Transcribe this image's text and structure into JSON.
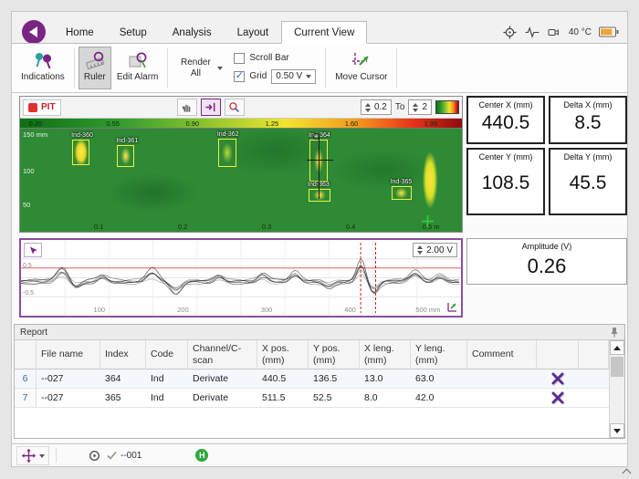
{
  "window": {
    "temperature": "40 °C"
  },
  "tabs": {
    "items": [
      "Home",
      "Setup",
      "Analysis",
      "Layout",
      "Current View"
    ]
  },
  "ribbon": {
    "indications_label": "Indications",
    "ruler_label": "Ruler",
    "edit_alarm_label": "Edit Alarm",
    "render_all_label": "Render All",
    "scroll_bar_label": "Scroll Bar",
    "grid_label": "Grid",
    "grid_value": "0.50 V",
    "move_cursor_label": "Move Cursor"
  },
  "cscan": {
    "channel_label": "PIT",
    "range_from": "0.2",
    "to_label": "To",
    "range_to": "2",
    "colorbar_ticks": [
      "0.20",
      "0.55",
      "0.90",
      "1.25",
      "1.60",
      "1.95"
    ],
    "y_ticks": [
      "150 mm",
      "100",
      "50"
    ],
    "x_ticks": [
      "0.1",
      "0.2",
      "0.3",
      "0.4",
      "0.5 m"
    ],
    "indications": [
      {
        "label": "Ind-360"
      },
      {
        "label": "Ind-361"
      },
      {
        "label": "Ind-362"
      },
      {
        "label": "Ind-364"
      },
      {
        "label": "Ind-363"
      },
      {
        "label": "Ind-365"
      }
    ]
  },
  "strip": {
    "scale_value": "2.00 V",
    "x_ticks": [
      "100",
      "200",
      "300",
      "400",
      "500 mm"
    ],
    "y_ticks": [
      "0.5",
      "-0.5"
    ]
  },
  "measurements": [
    {
      "label": "Center X (mm)",
      "value": "440.5"
    },
    {
      "label": "Delta X (mm)",
      "value": "8.5"
    },
    {
      "label": "Center Y (mm)",
      "value": "108.5"
    },
    {
      "label": "Delta Y (mm)",
      "value": "45.5"
    }
  ],
  "amplitude": {
    "label": "Amplitude (V)",
    "value": "0.26"
  },
  "report": {
    "title": "Report",
    "columns": [
      "File name",
      "Index",
      "Code",
      "Channel/C-scan",
      "X pos. (mm)",
      "Y pos. (mm)",
      "X leng. (mm)",
      "Y leng. (mm)",
      "Comment"
    ],
    "rows": [
      {
        "num": "6",
        "file_name": "--027",
        "index": "364",
        "code": "Ind",
        "channel": "Derivate",
        "x_pos": "440.5",
        "y_pos": "136.5",
        "x_len": "13.0",
        "y_len": "63.0",
        "comment": ""
      },
      {
        "num": "7",
        "file_name": "--027",
        "index": "365",
        "code": "Ind",
        "channel": "Derivate",
        "x_pos": "511.5",
        "y_pos": "52.5",
        "x_len": "8.0",
        "y_len": "42.0",
        "comment": ""
      }
    ]
  },
  "statusbar": {
    "file_label": "--001",
    "hardware_badge": "H"
  },
  "colors": {
    "accent_purple": "#7a2483",
    "cscan_green": "#2e8a35",
    "alarm_red": "#d03030",
    "battery_orange": "#f2a33a"
  }
}
